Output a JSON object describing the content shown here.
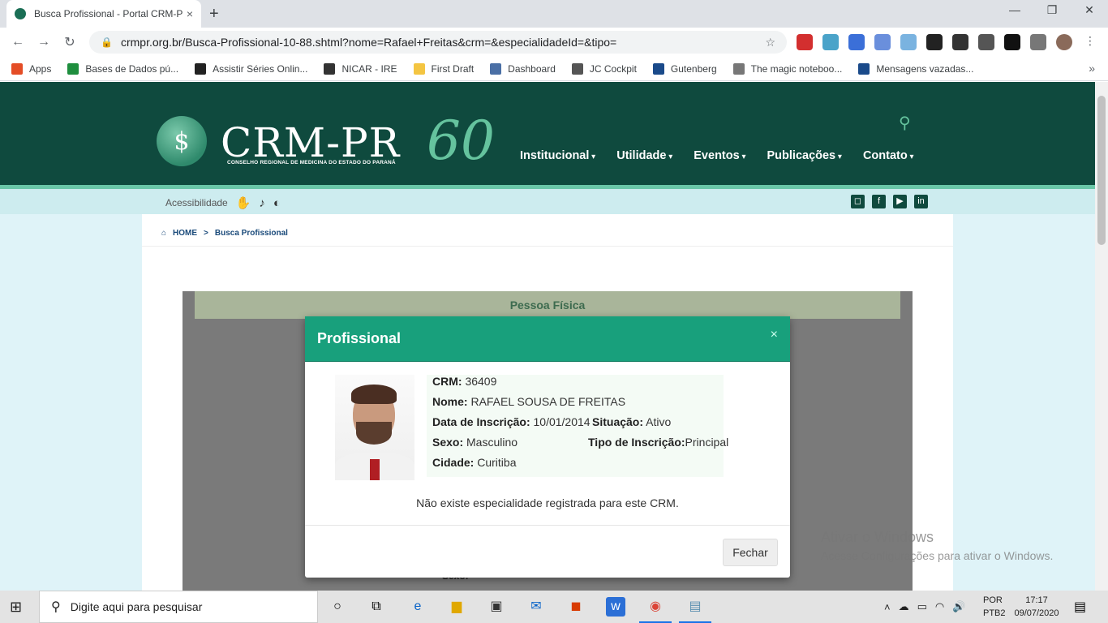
{
  "browser": {
    "tab_title": "Busca Profissional - Portal CRM-P",
    "tab_close": "×",
    "new_tab": "+",
    "url": "crmpr.org.br/Busca-Profissional-10-88.shtml?nome=Rafael+Freitas&crm=&especialidadeId=&tipo=",
    "win_minimize": "—",
    "win_restore": "❐",
    "win_close": "✕",
    "back": "←",
    "forward": "→",
    "reload": "↻",
    "lock": "🔒",
    "star": "☆",
    "bookmarks": [
      {
        "label": "Apps",
        "color": "#e44d26"
      },
      {
        "label": "Bases de Dados pú...",
        "color": "#1e8e3e"
      },
      {
        "label": "Assistir Séries Onlin...",
        "color": "#222222"
      },
      {
        "label": "NICAR - IRE",
        "color": "#333333"
      },
      {
        "label": "First Draft",
        "color": "#f4c542"
      },
      {
        "label": "Dashboard",
        "color": "#4a6fa5"
      },
      {
        "label": "JC Cockpit",
        "color": "#555555"
      },
      {
        "label": "Gutenberg",
        "color": "#1a4a8a"
      },
      {
        "label": "The magic noteboo...",
        "color": "#777777"
      },
      {
        "label": "Mensagens vazadas...",
        "color": "#1a4a8a"
      }
    ],
    "bookmarks_more": "»"
  },
  "site": {
    "logo_seal": "$",
    "logo_text": "CRM-PR",
    "logo_sub": "CONSELHO REGIONAL DE MEDICINA DO ESTADO DO PARANÁ",
    "logo_60": "60",
    "search_icon": "⚲",
    "nav": [
      "Institucional",
      "Utilidade",
      "Eventos",
      "Publicações",
      "Contato"
    ],
    "accessibility_label": "Acessibilidade",
    "acc_icons": [
      "✋",
      "♪",
      "◐"
    ],
    "social": [
      "◻",
      "f",
      "▶",
      "in"
    ],
    "breadcrumb": {
      "home_icon": "⌂",
      "home": "HOME",
      "sep": ">",
      "current": "Busca Profissional"
    },
    "pessoa_fisica": "Pessoa Física",
    "behind_label": "Sexo:"
  },
  "modal": {
    "title": "Profissional",
    "close_x": "×",
    "crm_label": "CRM:",
    "crm_value": "36409",
    "nome_label": "Nome:",
    "nome_value": "RAFAEL SOUSA DE FREITAS",
    "data_label": "Data de Inscrição:",
    "data_value": "10/01/2014",
    "situacao_label": "Situação:",
    "situacao_value": "Ativo",
    "sexo_label": "Sexo:",
    "sexo_value": "Masculino",
    "tipo_label": "Tipo de Inscrição:",
    "tipo_value": "Principal",
    "cidade_label": "Cidade:",
    "cidade_value": "Curitiba",
    "no_specialty": "Não existe especialidade registrada para este CRM.",
    "close_button": "Fechar"
  },
  "watermark": {
    "line1": "Ativar o Windows",
    "line2": "Acesse Configurações para ativar o Windows."
  },
  "taskbar": {
    "start_icon": "⊞",
    "search_icon": "⚲",
    "search_placeholder": "Digite aqui para pesquisar",
    "apps": [
      "○",
      "⧉",
      "e",
      "▆",
      "▣",
      "✉",
      "◼",
      "w",
      "◉",
      "▤"
    ],
    "tray_icons": [
      "˄",
      "☁",
      "▭",
      "◠",
      "🔊"
    ],
    "lang1": "POR",
    "lang2": "PTB2",
    "time": "17:17",
    "date": "09/07/2020",
    "notif_icon": "▤"
  }
}
